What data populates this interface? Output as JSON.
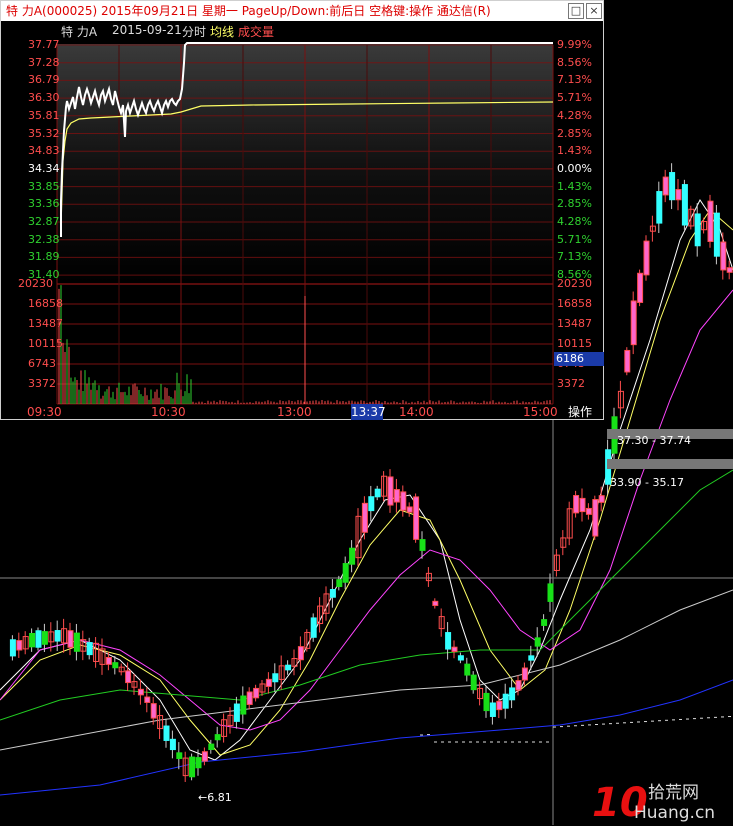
{
  "window": {
    "title": "特 力A(000025) 2015年09月21日 星期一 PageUp/Down:前后日 空格键:操作 通达信(R)",
    "restore_glyph": "□",
    "close_glyph": "×"
  },
  "intraday": {
    "name": "特 力A",
    "date": "2015-09-21",
    "mode": "分时",
    "avg_label": "均线",
    "vol_label": "成交量",
    "price_axis": [
      "37.77",
      "37.28",
      "36.79",
      "36.30",
      "35.81",
      "35.32",
      "34.83",
      "34.34",
      "33.85",
      "33.36",
      "32.87",
      "32.38",
      "31.89",
      "31.40"
    ],
    "pct_axis": [
      "9.99%",
      "8.56%",
      "7.13%",
      "5.71%",
      "4.28%",
      "2.85%",
      "1.43%",
      "0.00%",
      "1.43%",
      "2.85%",
      "4.28%",
      "5.71%",
      "7.13%",
      "8.56%"
    ],
    "volume_axis": [
      "20230",
      "16858",
      "13487",
      "10115",
      "6743",
      "3372"
    ],
    "current_volume": "6186",
    "times": [
      "09:30",
      "10:30",
      "13:00",
      "14:00",
      "15:00"
    ],
    "cursor_time": "13:37",
    "op_button": "操作",
    "colors": {
      "up": "#ff4e4e",
      "down": "#2fd12f",
      "price_line": "#ffffff",
      "avg_line": "#ffff66",
      "cursor_badge": "#1a3aa8"
    }
  },
  "kline": {
    "low_marker": "6.81",
    "range_high": "37.30 - 37.74",
    "range_low": "33.90 - 35.17",
    "colors": {
      "up": "#ff4e4e",
      "down": "#18e018",
      "up_fill": "#ff66cc",
      "down_fill": "#33ffff",
      "ma5": "#ffffff",
      "ma10": "#ffff66",
      "ma20": "#ff44ff",
      "ma60": "#22cc22",
      "ma120": "#cccccc",
      "ma250": "#2233ff"
    }
  },
  "watermark": {
    "logo": "10",
    "text_cn": "拾荒网",
    "text_en": "Huang.cn"
  }
}
